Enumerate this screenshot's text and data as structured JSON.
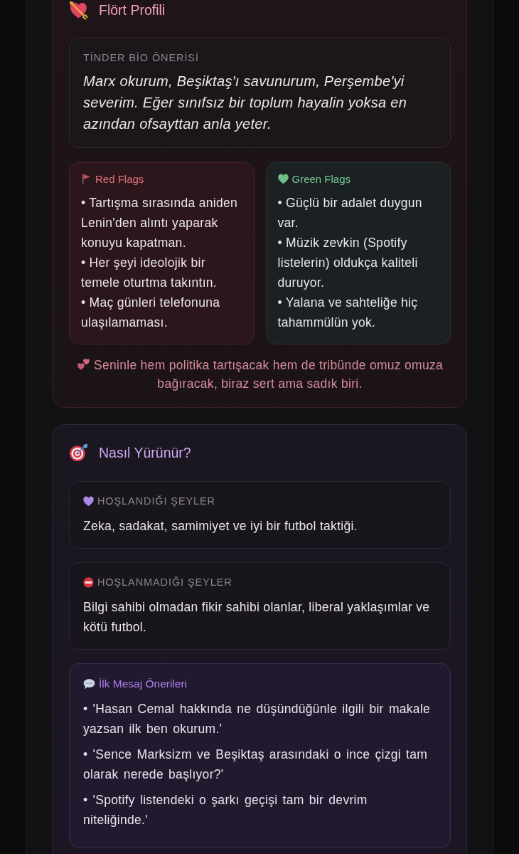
{
  "profile_card": {
    "title": "Flört Profili",
    "bio": {
      "label": "TİNDER BİO ÖNERİSİ",
      "text": "Marx okurum, Beşiktaş'ı savunurum, Perşembe'yi severim. Eğer sınıfsız bir toplum hayalin yoksa en azından ofsayttan anla yeter."
    },
    "flags": [
      {
        "kind": "red",
        "title": "Red Flags",
        "items": [
          "• Tartışma sırasında aniden Lenin'den alıntı yaparak konuyu kapatman.",
          "• Her şeyi ideolojik bir temele oturtma takıntın.",
          "• Maç günleri telefonuna ulaşılamaması."
        ]
      },
      {
        "kind": "green",
        "title": "Green Flags",
        "items": [
          "• Güçlü bir adalet duygun var.",
          "• Müzik zevkin (Spotify listelerin) oldukça kaliteli duruyor.",
          "• Yalana ve sahteliğe hiç tahammülün yok."
        ]
      }
    ],
    "summary": "Seninle hem politika tartışacak hem de tribünde omuz omuza bağıracak, biraz sert ama sadık biri."
  },
  "approach_card": {
    "title": "Nasıl Yürünür?",
    "sections": [
      {
        "kind": "likes",
        "label": "HOŞLANDIĞI ŞEYLER",
        "text": "Zeka, sadakat, samimiyet ve iyi bir futbol taktiği."
      },
      {
        "kind": "dislikes",
        "label": "HOŞLANMADIĞI ŞEYLER",
        "text": "Bilgi sahibi olmadan fikir sahibi olanlar, liberal yaklaşımlar ve kötü futbol."
      }
    ],
    "first_messages": {
      "title": "İlk Mesaj Önerileri",
      "items": [
        "• 'Hasan Cemal hakkında ne düşündüğünle ilgili bir makale yazsan ilk ben okurum.'",
        "• 'Sence Marksizm ve Beşiktaş arasındaki o ince çizgi tam olarak nerede başlıyor?'",
        "• 'Spotify listendeki o şarkı geçişi tam bir devrim niteliğinde.'"
      ]
    }
  }
}
